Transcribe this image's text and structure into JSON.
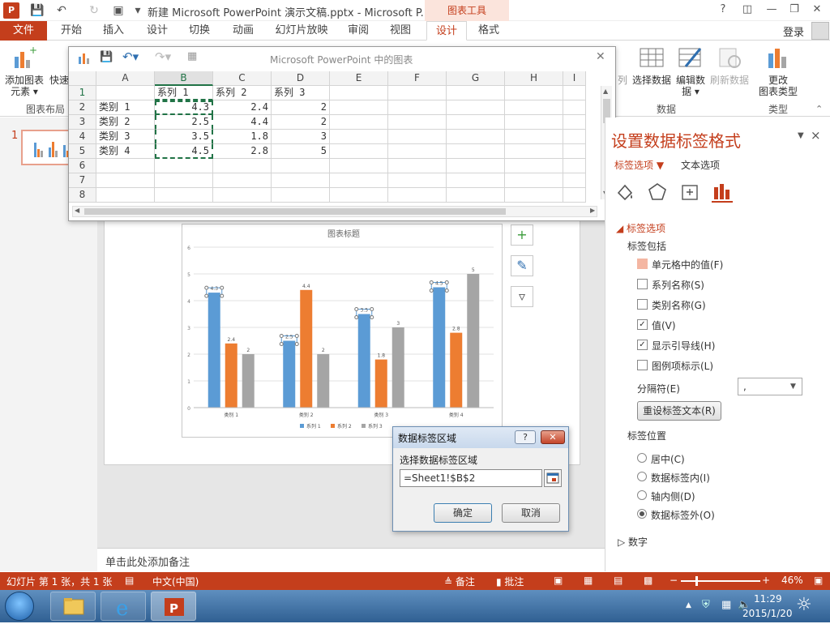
{
  "titlebar": {
    "title": "新建 Microsoft PowerPoint 演示文稿.pptx - Microsoft P...",
    "chart_tools": "图表工具",
    "help": "?",
    "app_icon": "P"
  },
  "tabs": {
    "file": "文件",
    "items": [
      "开始",
      "插入",
      "设计",
      "切换",
      "动画",
      "幻灯片放映",
      "审阅",
      "视图",
      "设计",
      "格式"
    ],
    "login": "登录"
  },
  "ribbon": {
    "add_element": "添加图表",
    "add_element2": "元素",
    "quick": "快速",
    "layout_group": "图表布局",
    "switch_col": "列",
    "select_data": "选择数据",
    "edit_data": "编辑数",
    "edit_data2": "据",
    "refresh_data": "刷新数据",
    "data_group": "数据",
    "change_type": "更改",
    "change_type2": "图表类型",
    "type_group": "类型"
  },
  "thumbs": {
    "slide_number": "1"
  },
  "sheet": {
    "title": "Microsoft PowerPoint 中的图表",
    "columns": [
      "A",
      "B",
      "C",
      "D",
      "E",
      "F",
      "G",
      "H",
      "I"
    ],
    "rows": [
      [
        "1",
        "",
        "系列 1",
        "系列 2",
        "系列 3"
      ],
      [
        "2",
        "类别 1",
        "4.3",
        "2.4",
        "2"
      ],
      [
        "3",
        "类别 2",
        "2.5",
        "4.4",
        "2"
      ],
      [
        "4",
        "类别 3",
        "3.5",
        "1.8",
        "3"
      ],
      [
        "5",
        "类别 4",
        "4.5",
        "2.8",
        "5"
      ],
      [
        "6",
        "",
        "",
        "",
        ""
      ],
      [
        "7",
        "",
        "",
        "",
        ""
      ],
      [
        "8",
        "",
        "",
        "",
        ""
      ]
    ]
  },
  "chart_data": {
    "type": "bar",
    "title": "图表标题",
    "categories": [
      "类别 1",
      "类别 2",
      "类别 3",
      "类别 4"
    ],
    "series": [
      {
        "name": "系列 1",
        "values": [
          4.3,
          2.5,
          3.5,
          4.5
        ],
        "color": "#5b9bd5"
      },
      {
        "name": "系列 2",
        "values": [
          2.4,
          4.4,
          1.8,
          2.8
        ],
        "color": "#ed7d31"
      },
      {
        "name": "系列 3",
        "values": [
          2,
          2,
          3,
          5
        ],
        "color": "#a5a5a5"
      }
    ],
    "ylim": [
      0,
      6
    ],
    "yticks": [
      "0",
      "1",
      "2",
      "3",
      "4",
      "5",
      "6"
    ],
    "legend": "bottom",
    "grid": true
  },
  "notes": {
    "placeholder": "单击此处添加备注"
  },
  "panel": {
    "title": "设置数据标签格式",
    "tab_label_options": "标签选项",
    "tab_text_options": "文本选项",
    "section": "标签选项",
    "includes": "标签包括",
    "options": [
      {
        "label": "单元格中的值(F)",
        "checked": true
      },
      {
        "label": "系列名称(S)",
        "checked": false
      },
      {
        "label": "类别名称(G)",
        "checked": false
      },
      {
        "label": "值(V)",
        "checked": true
      },
      {
        "label": "显示引导线(H)",
        "checked": true
      },
      {
        "label": "图例项标示(L)",
        "checked": false
      }
    ],
    "separator_label": "分隔符(E)",
    "separator_value": ",",
    "reset_button": "重设标签文本(R)",
    "position_label": "标签位置",
    "positions": [
      {
        "label": "居中(C)",
        "selected": false
      },
      {
        "label": "数据标签内(I)",
        "selected": false
      },
      {
        "label": "轴内侧(D)",
        "selected": false
      },
      {
        "label": "数据标签外(O)",
        "selected": true
      }
    ],
    "number_section": "数字",
    "close": "×"
  },
  "dialog": {
    "title": "数据标签区域",
    "prompt": "选择数据标签区域",
    "value": "=Sheet1!$B$2",
    "ok": "确定",
    "cancel": "取消",
    "help": "?"
  },
  "status": {
    "slide_info": "幻灯片 第 1 张，共 1 张",
    "language": "中文(中国)",
    "notes": "备注",
    "comments": "批注",
    "zoom": "46%"
  },
  "taskbar": {
    "time": "11:29",
    "date": "2015/1/20"
  }
}
